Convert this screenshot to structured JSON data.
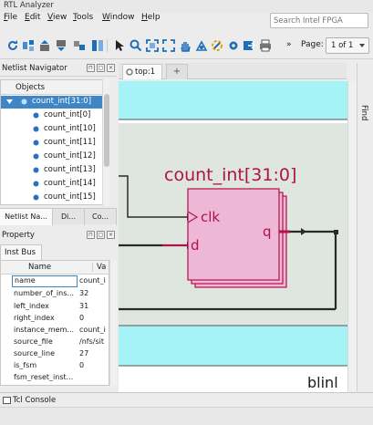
{
  "window": {
    "title": "RTL Analyzer"
  },
  "menu": [
    {
      "label": "File",
      "mnemonic": "F",
      "rest": "ile"
    },
    {
      "label": "Edit",
      "mnemonic": "E",
      "rest": "dit"
    },
    {
      "label": "View",
      "mnemonic": "V",
      "rest": "iew"
    },
    {
      "label": "Tools",
      "mnemonic": "T",
      "rest": "ools"
    },
    {
      "label": "Window",
      "mnemonic": "W",
      "rest": "indow"
    },
    {
      "label": "Help",
      "mnemonic": "H",
      "rest": "elp"
    }
  ],
  "search": {
    "placeholder": "Search Intel FPGA"
  },
  "toolbar": {
    "more": "»",
    "page_label": "Page:",
    "page_value": "1 of 1"
  },
  "navigator": {
    "title": "Netlist Navigator",
    "column": "Objects",
    "selected": "count_int[31:0]",
    "children": [
      "count_int[0]",
      "count_int[10]",
      "count_int[11]",
      "count_int[12]",
      "count_int[13]",
      "count_int[14]",
      "count_int[15]"
    ]
  },
  "bottom_tabs": [
    "Netlist Na...",
    "Di...",
    "Co..."
  ],
  "properties": {
    "title": "Property",
    "tab": "Inst Bus",
    "col_name": "Name",
    "col_value": "Va",
    "rows": [
      {
        "name": "name",
        "value": "count_i"
      },
      {
        "name": "number_of_ins...",
        "value": "32"
      },
      {
        "name": "left_index",
        "value": "31"
      },
      {
        "name": "right_index",
        "value": "0"
      },
      {
        "name": "instance_mem...",
        "value": "count_i"
      },
      {
        "name": "source_file",
        "value": "/nfs/sit"
      },
      {
        "name": "source_line",
        "value": "27"
      },
      {
        "name": "is_fsm",
        "value": "0"
      },
      {
        "name": "fsm_reset_inst...",
        "value": ""
      }
    ]
  },
  "view": {
    "tab": "top:1",
    "add_tab": "+",
    "find": "Find"
  },
  "schematic": {
    "instance": "count_int[31:0]",
    "ports": {
      "clk": "clk",
      "d": "d",
      "q": "q"
    },
    "bottom_text": "blinl"
  },
  "console": {
    "label": "Tcl Console"
  },
  "colors": {
    "module_fill": "#efb7d6",
    "module_stroke": "#b0124a",
    "wire": "#2a2a2a",
    "bus": "#b0124a",
    "band": "#a5f2f7",
    "region": "#dfe5df",
    "selection": "#3f86c6"
  }
}
